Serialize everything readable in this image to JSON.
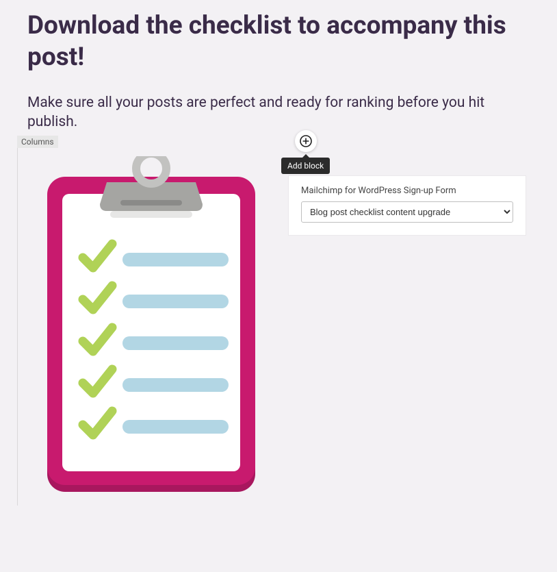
{
  "heading": "Download the checklist to accompany this post!",
  "subheading": "Make sure all your posts are perfect and ready for ranking before you hit publish.",
  "columns_label": "Columns",
  "add_block": {
    "tooltip": "Add block"
  },
  "form": {
    "label": "Mailchimp for WordPress Sign-up Form",
    "selected": "Blog post checklist content upgrade"
  },
  "colors": {
    "clipboard_board": "#c81a6e",
    "clipboard_board_dark": "#a8175e",
    "clip_light": "#c2c2c0",
    "clip_mid": "#a5a5a2",
    "clip_dark": "#8a8a88",
    "check": "#b0d257",
    "line": "#b2d6e4"
  }
}
